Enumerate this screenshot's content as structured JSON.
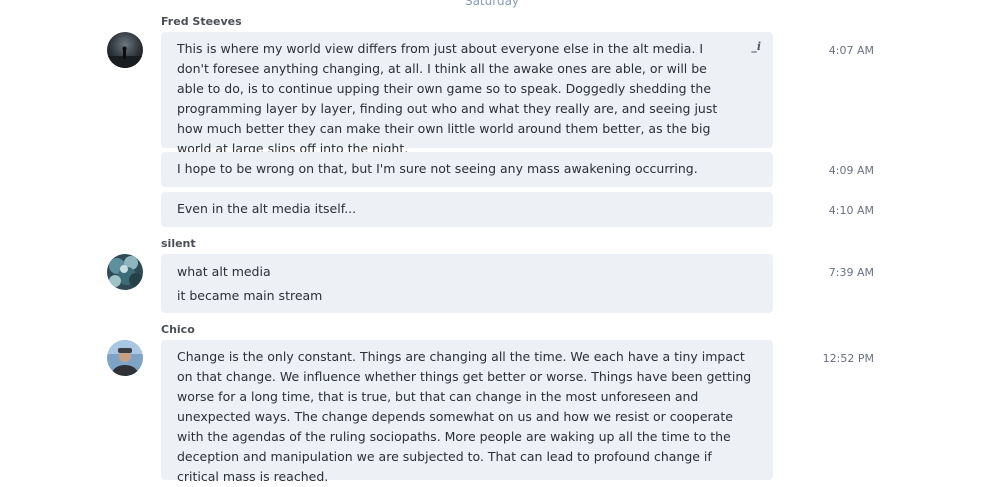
{
  "day_divider": "Saturday",
  "groups": [
    {
      "sender": "Fred Steeves",
      "messages": [
        {
          "text": "This is where my world view differs from just about everyone else in the alt media. I don't foresee anything changing, at all. I think all the awake ones are able, or will be able to do, is to continue upping their own game so to speak. Doggedly shedding the programming layer by layer, finding out who and what they really are, and seeing just how much better they can make their own little world around them better, as the big world at large slips off into the night.",
          "time": "4:07 AM",
          "edit_icon": "pencil-icon"
        },
        {
          "text": "I hope to be wrong on that, but I'm sure not seeing any mass awakening occurring.",
          "time": "4:09 AM"
        },
        {
          "text": "Even in the alt media itself...",
          "time": "4:10 AM"
        }
      ]
    },
    {
      "sender": "silent",
      "messages": [
        {
          "lines": [
            "what alt media",
            "it became main stream"
          ],
          "time": "7:39 AM"
        }
      ]
    },
    {
      "sender": "Chico",
      "messages": [
        {
          "text": "Change is the only constant.  Things are changing all the time.  We each have a tiny impact on that change.  We influence whether things get better or worse.  Things have been getting worse for a long time, that is true, but that can change in the most unforeseen and unexpected ways.  The change depends somewhat on us and how we resist or cooperate with the agendas of the ruling sociopaths.  More people are waking up all the time to the deception and manipulation we are subjected to.  That can lead to profound change if critical mass is reached.",
          "time": "12:52 PM"
        }
      ]
    }
  ],
  "colors": {
    "bubble_bg": "#edf0f5",
    "day_divider": "#8a9bb8",
    "timestamp": "#6b7280"
  }
}
